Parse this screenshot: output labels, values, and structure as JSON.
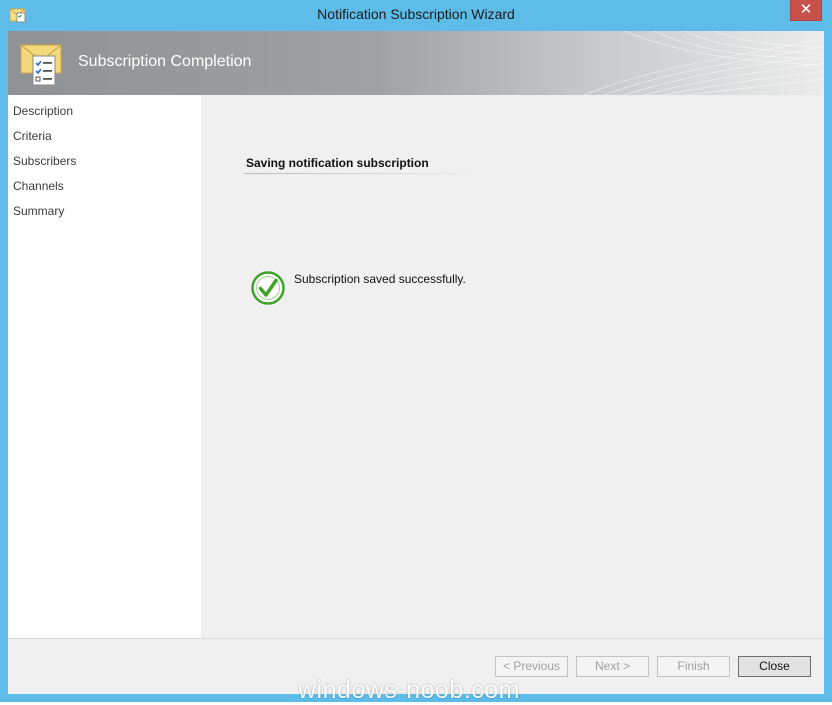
{
  "window": {
    "title": "Notification Subscription Wizard",
    "close_glyph": "✕",
    "icon": "wizard-app-icon"
  },
  "banner": {
    "title": "Subscription Completion",
    "icon": "envelope-checklist-icon"
  },
  "nav": {
    "items": [
      {
        "label": "Description"
      },
      {
        "label": "Criteria"
      },
      {
        "label": "Subscribers"
      },
      {
        "label": "Channels"
      },
      {
        "label": "Summary"
      }
    ]
  },
  "main": {
    "section_title": "Saving notification subscription",
    "status_icon": "success-check-icon",
    "status_message": "Subscription saved successfully."
  },
  "buttons": {
    "previous": "< Previous",
    "next": "Next >",
    "finish": "Finish",
    "close": "Close"
  },
  "watermark": "windows-noob.com",
  "colors": {
    "frame": "#5ebce9",
    "close_button": "#c7504a",
    "success_green": "#3fa32a"
  }
}
